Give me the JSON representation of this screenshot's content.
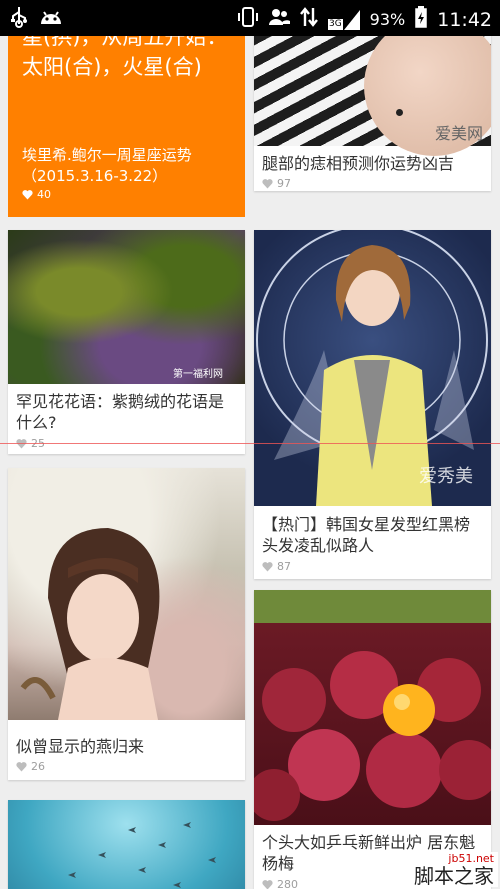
{
  "status": {
    "network": "3G",
    "battery": "93%",
    "time": "11:42"
  },
  "cards": [
    {
      "big_line1": "星(拱)，从周五开始：",
      "big_line2": "太阳(合)，火星(合)",
      "title": "埃里希.鲍尔一周星座运势（2015.3.16-3.22）",
      "likes": "40"
    },
    {
      "title": "腿部的痣相预测你运势凶吉",
      "likes": "97",
      "overlay": "爱美网"
    },
    {
      "title": "罕见花花语：紫鹅绒的花语是什么?",
      "likes": "25",
      "overlay": "第一福利网"
    },
    {
      "title": "【热门】韩国女星发型红黑榜头发凌乱似路人",
      "likes": "87",
      "overlay": "爱秀美"
    },
    {
      "title": "似曾显示的燕归来",
      "likes": "26"
    },
    {
      "title": "个头大如乒乓新鲜出炉 居东魁杨梅",
      "likes": "280"
    }
  ],
  "watermark": {
    "site": "脚本之家",
    "url": "jb51.net"
  }
}
